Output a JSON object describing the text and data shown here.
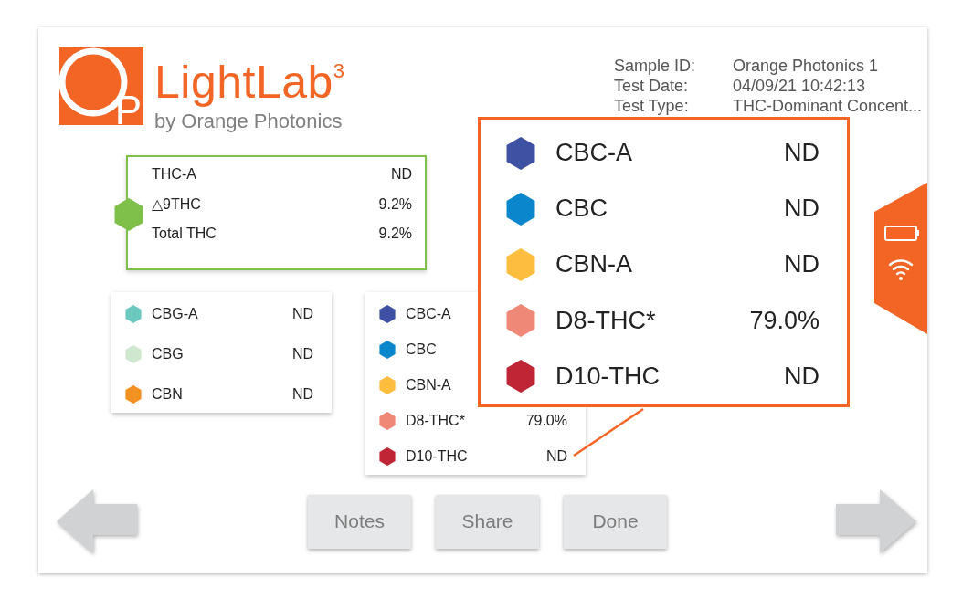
{
  "logo": {
    "mark_letter": "P",
    "title": "LightLab$^{3}$",
    "subtitle": "by Orange Photonics"
  },
  "sample_info": [
    {
      "label": "Sample ID:",
      "value": "Orange Photonics 1"
    },
    {
      "label": "Test Date:",
      "value": "04/09/21 10:42:13"
    },
    {
      "label": "Test Type:",
      "value": "THC-Dominant Concent..."
    }
  ],
  "summary_card": {
    "color": "#7ec04a",
    "rows": [
      {
        "name": "THC-A",
        "value": "ND"
      },
      {
        "name": "△9THC",
        "value": "9.2%"
      },
      {
        "name": "Total THC",
        "value": "9.2%"
      }
    ]
  },
  "cards": [
    {
      "items": [
        {
          "name": "CBG-A",
          "value": "ND",
          "color": "#6cc9bf"
        },
        {
          "name": "CBG",
          "value": "ND",
          "color": "#cfe6cf"
        },
        {
          "name": "CBN",
          "value": "ND",
          "color": "#f39222"
        }
      ]
    },
    {
      "items": [
        {
          "name": "CBC-A",
          "color": "#3f51a3"
        },
        {
          "name": "CBC",
          "color": "#0a87cc"
        },
        {
          "name": "CBN-A",
          "color": "#fdbd3f"
        },
        {
          "name": "D8-THC*",
          "value": "79.0%",
          "color": "#f08878"
        },
        {
          "name": "D10-THC",
          "value": "ND",
          "color": "#c02535"
        }
      ]
    }
  ],
  "zoom_popup": {
    "items": [
      {
        "name": "CBC-A",
        "value": "ND",
        "color": "#3f51a3"
      },
      {
        "name": "CBC",
        "value": "ND",
        "color": "#0a87cc"
      },
      {
        "name": "CBN-A",
        "value": "ND",
        "color": "#fdbd3f"
      },
      {
        "name": "D8-THC*",
        "value": "79.0%",
        "color": "#f08878"
      },
      {
        "name": "D10-THC",
        "value": "ND",
        "color": "#c02535"
      }
    ]
  },
  "buttons": [
    "Notes",
    "Share",
    "Done"
  ]
}
